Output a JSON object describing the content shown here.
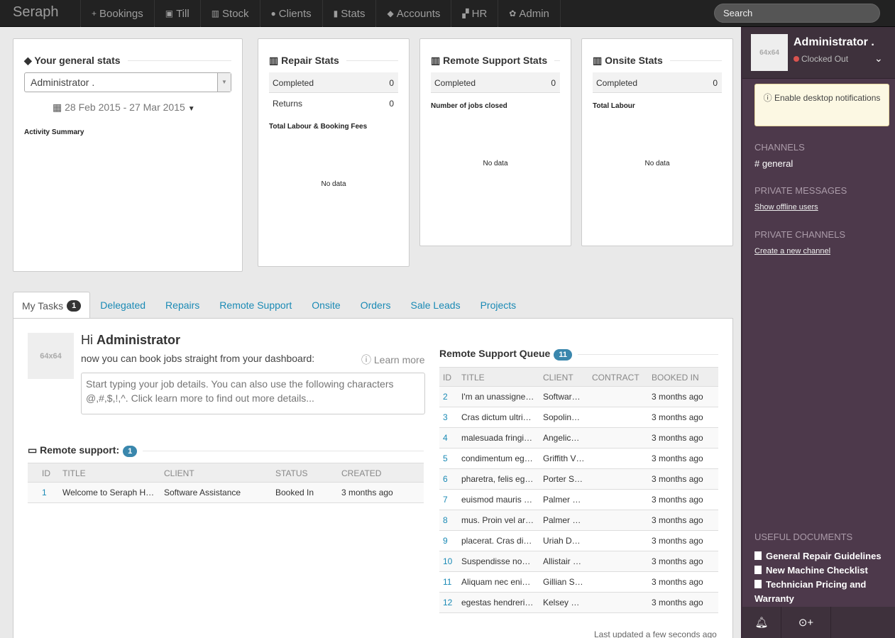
{
  "nav": {
    "brand": "Seraph",
    "items": [
      {
        "label": "Bookings",
        "icon": "plus-icon",
        "glyph": "+"
      },
      {
        "label": "Till",
        "icon": "cash-icon",
        "glyph": "▣"
      },
      {
        "label": "Stock",
        "icon": "barcode-icon",
        "glyph": "▥"
      },
      {
        "label": "Clients",
        "icon": "user-icon",
        "glyph": "●"
      },
      {
        "label": "Stats",
        "icon": "bar-chart-icon",
        "glyph": "▮"
      },
      {
        "label": "Accounts",
        "icon": "tag-icon",
        "glyph": "◆"
      },
      {
        "label": "HR",
        "icon": "sitemap-icon",
        "glyph": "▞"
      },
      {
        "label": "Admin",
        "icon": "gears-icon",
        "glyph": "✿"
      }
    ],
    "search_placeholder": "Search"
  },
  "general_stats": {
    "title": "Your general stats",
    "user_select": "Administrator .",
    "date_range": "28 Feb 2015 - 27 Mar 2015",
    "activity_label": "Activity Summary"
  },
  "repair_stats": {
    "title": "Repair Stats",
    "rows": [
      {
        "label": "Completed",
        "value": "0"
      },
      {
        "label": "Returns",
        "value": "0"
      }
    ],
    "chart_label": "Total Labour & Booking Fees",
    "no_data": "No data"
  },
  "remote_stats": {
    "title": "Remote Support Stats",
    "rows": [
      {
        "label": "Completed",
        "value": "0"
      }
    ],
    "chart_label": "Number of jobs closed",
    "no_data": "No data"
  },
  "onsite_stats": {
    "title": "Onsite Stats",
    "rows": [
      {
        "label": "Completed",
        "value": "0"
      }
    ],
    "chart_label": "Total Labour",
    "no_data": "No data"
  },
  "tabs": {
    "my_tasks": "My Tasks",
    "my_tasks_count": "1",
    "others": [
      "Delegated",
      "Repairs",
      "Remote Support",
      "Onsite",
      "Orders",
      "Sale Leads",
      "Projects"
    ]
  },
  "dashboard": {
    "avatar": "64x64",
    "greeting": "Hi",
    "user": "Administrator",
    "hint": "now you can book jobs straight from your dashboard:",
    "learn_more": "Learn more",
    "textarea_placeholder": "Start typing your job details. You can also use the following characters @,#,$,!,^. Click learn more to find out more details..."
  },
  "remote_support": {
    "title": "Remote support:",
    "count": "1",
    "headers": [
      "ID",
      "TITLE",
      "CLIENT",
      "STATUS",
      "CREATED"
    ],
    "rows": [
      [
        "1",
        "Welcome to Seraph H…",
        "Software Assistance",
        "Booked In",
        "3 months ago"
      ]
    ]
  },
  "queue": {
    "title": "Remote Support Queue",
    "count": "11",
    "headers": [
      "ID",
      "TITLE",
      "CLIENT",
      "CONTRACT",
      "BOOKED IN"
    ],
    "rows": [
      [
        "2",
        "I'm an unassigne…",
        "Softwar…",
        "",
        "3 months ago"
      ],
      [
        "3",
        "Cras dictum ultri…",
        "Sopolin…",
        "",
        "3 months ago"
      ],
      [
        "4",
        "malesuada fringi…",
        "Angelic…",
        "",
        "3 months ago"
      ],
      [
        "5",
        "condimentum eg…",
        "Griffith V…",
        "",
        "3 months ago"
      ],
      [
        "6",
        "pharetra, felis eg…",
        "Porter S…",
        "",
        "3 months ago"
      ],
      [
        "7",
        "euismod mauris …",
        "Palmer …",
        "",
        "3 months ago"
      ],
      [
        "8",
        "mus. Proin vel ar…",
        "Palmer …",
        "",
        "3 months ago"
      ],
      [
        "9",
        "placerat. Cras di…",
        "Uriah D…",
        "",
        "3 months ago"
      ],
      [
        "10",
        "Suspendisse no…",
        "Allistair …",
        "",
        "3 months ago"
      ],
      [
        "11",
        "Aliquam nec eni…",
        "Gillian S…",
        "",
        "3 months ago"
      ],
      [
        "12",
        "egestas hendreri…",
        "Kelsey …",
        "",
        "3 months ago"
      ]
    ],
    "last_updated": "Last updated a few seconds ago"
  },
  "sidebar": {
    "avatar": "64x64",
    "name": "Administrator .",
    "status": "Clocked Out",
    "notify": "Enable desktop notifications",
    "channels_heading": "CHANNELS",
    "channel": "# general",
    "pm_heading": "PRIVATE MESSAGES",
    "show_offline": "Show offline users",
    "private_channels_heading": "PRIVATE CHANNELS",
    "create_channel": "Create a new channel",
    "docs_heading": "USEFUL DOCUMENTS",
    "docs": [
      "General Repair Guidelines",
      "New Machine Checklist",
      "Technician Pricing and Warranty"
    ]
  }
}
